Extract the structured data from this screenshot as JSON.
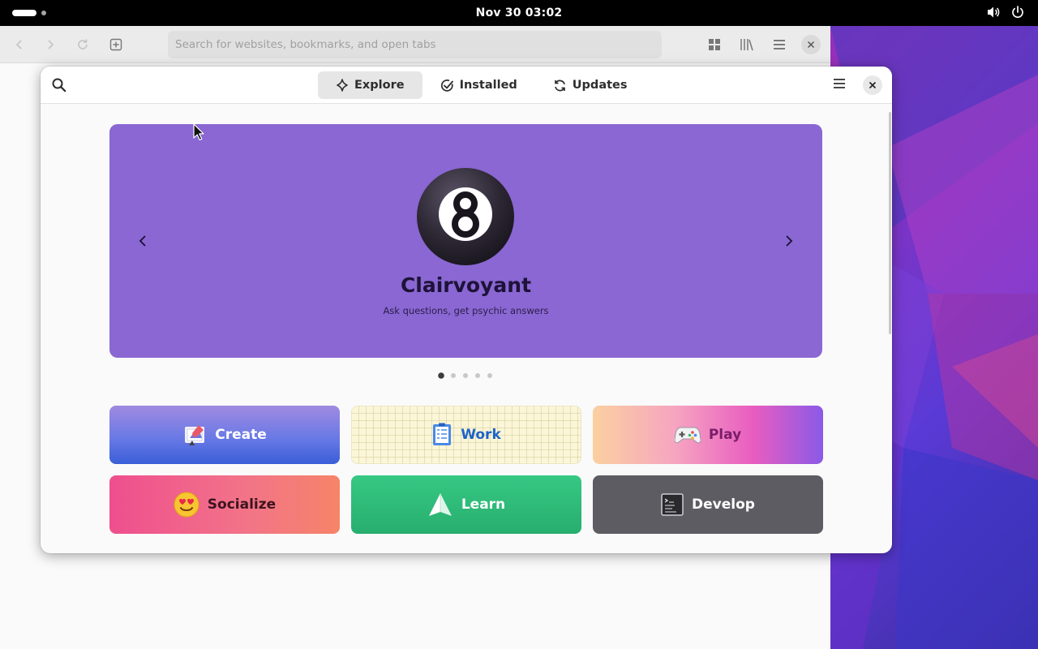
{
  "topbar": {
    "clock": "Nov 30  03:02",
    "icons": [
      "activities-indicator",
      "volume-icon",
      "power-icon"
    ]
  },
  "browser": {
    "url_placeholder": "Search for websites, bookmarks, and open tabs",
    "icons": [
      "back-icon",
      "forward-icon",
      "reload-icon",
      "new-tab-icon",
      "tab-overview-icon",
      "library-icon",
      "hamburger-menu-icon",
      "close-icon"
    ]
  },
  "software": {
    "tabs": [
      {
        "label": "Explore",
        "icon": "sparkle-icon",
        "active": true
      },
      {
        "label": "Installed",
        "icon": "check-circle-icon",
        "active": false
      },
      {
        "label": "Updates",
        "icon": "refresh-icon",
        "active": false
      }
    ],
    "featured": {
      "name": "Clairvoyant",
      "summary": "Ask questions, get psychic answers",
      "icon": "magic-8-ball-icon",
      "background": "#8a67d2",
      "slide_count": 5,
      "active_slide": 1
    },
    "categories": [
      {
        "label": "Create",
        "icon": "create-icon"
      },
      {
        "label": "Work",
        "icon": "work-icon"
      },
      {
        "label": "Play",
        "icon": "gamepad-icon"
      },
      {
        "label": "Socialize",
        "icon": "heart-eyes-emoji-icon"
      },
      {
        "label": "Learn",
        "icon": "paper-plane-icon"
      },
      {
        "label": "Develop",
        "icon": "terminal-icon"
      }
    ]
  }
}
